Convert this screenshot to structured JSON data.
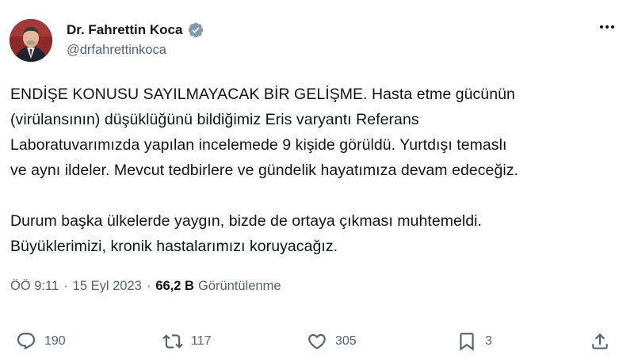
{
  "author": {
    "display_name": "Dr. Fahrettin Koca",
    "handle": "@drfahrettinkoca",
    "verified_icon": "verified-badge-icon"
  },
  "tweet": {
    "lines": [
      "ENDİŞE KONUSU SAYILMAYACAK BİR GELİŞME. Hasta etme gücünün",
      "(virülansının) düşüklüğünü bildiğimiz Eris varyantı Referans",
      "Laboratuvarımızda yapılan incelemede 9 kişide görüldü. Yurtdışı temaslı",
      "ve aynı ildeler. Mevcut tedbirlere ve gündelik hayatımıza devam edeceğiz.",
      "Durum başka ülkelerde yaygın, bizde de ortaya çıkması muhtemeldi.",
      "Büyüklerimizi, kronik hastalarımızı koruyacağız."
    ]
  },
  "meta": {
    "time": "ÖÖ 9:11",
    "separator": "·",
    "date": "15 Eyl 2023",
    "views_count": "66,2 B",
    "views_label": "Görüntülenme"
  },
  "actions": {
    "reply_count": "190",
    "repost_count": "117",
    "like_count": "305",
    "bookmark_count": "3"
  },
  "colors": {
    "text": "#0f1419",
    "secondary": "#536471",
    "verified": "#829aab"
  }
}
